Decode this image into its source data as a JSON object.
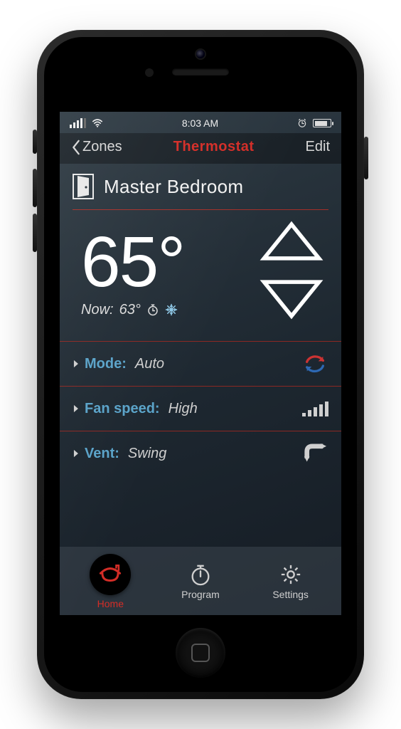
{
  "status": {
    "time": "8:03 AM"
  },
  "nav": {
    "back_label": "Zones",
    "title": "Thermostat",
    "edit_label": "Edit"
  },
  "room": {
    "name": "Master Bedroom"
  },
  "temp": {
    "setpoint": "65°",
    "now_prefix": "Now:",
    "now_value": "63°"
  },
  "rows": {
    "mode": {
      "label": "Mode:",
      "value": "Auto"
    },
    "fan": {
      "label": "Fan speed:",
      "value": "High"
    },
    "vent": {
      "label": "Vent:",
      "value": "Swing"
    }
  },
  "tabs": {
    "home": "Home",
    "program": "Program",
    "settings": "Settings"
  },
  "colors": {
    "accent": "#d42d27",
    "link": "#5aa3c9"
  }
}
